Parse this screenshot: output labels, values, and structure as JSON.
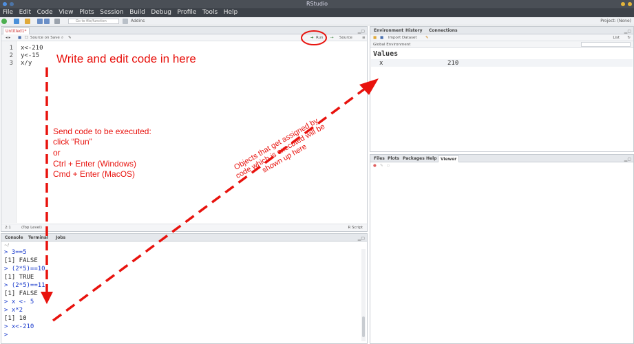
{
  "window": {
    "title": "RStudio"
  },
  "menu": [
    "File",
    "Edit",
    "Code",
    "View",
    "Plots",
    "Session",
    "Build",
    "Debug",
    "Profile",
    "Tools",
    "Help"
  ],
  "toolbar": {
    "goto_placeholder": "Go to file/function",
    "addins": "Addins",
    "project": "Project: (None)"
  },
  "editor": {
    "tab": "Untitled1*",
    "source_on_save": "Source on Save",
    "run": "Run",
    "source": "Source",
    "lines": [
      {
        "num": "1",
        "code": "x<-210"
      },
      {
        "num": "2",
        "code": "y<-15"
      },
      {
        "num": "3",
        "code": "x/y"
      }
    ],
    "status_pos": "2:1",
    "status_scope": "(Top Level)",
    "status_type": "R Script"
  },
  "console": {
    "tabs": [
      "Console",
      "Terminal",
      "Jobs"
    ],
    "path": "~/",
    "lines": [
      {
        "kind": "prompt",
        "text": "> 3==5"
      },
      {
        "kind": "out",
        "text": "[1] FALSE"
      },
      {
        "kind": "prompt",
        "text": "> (2*5)==10"
      },
      {
        "kind": "out",
        "text": "[1] TRUE"
      },
      {
        "kind": "prompt",
        "text": "> (2*5)==11"
      },
      {
        "kind": "out",
        "text": "[1] FALSE"
      },
      {
        "kind": "prompt",
        "text": "> x <- 5"
      },
      {
        "kind": "prompt",
        "text": "> x*2"
      },
      {
        "kind": "out",
        "text": "[1] 10"
      },
      {
        "kind": "prompt",
        "text": "> x<-210"
      },
      {
        "kind": "prompt",
        "text": ">"
      }
    ]
  },
  "environment": {
    "tabs": [
      "Environment",
      "History",
      "Connections"
    ],
    "import": "Import Dataset",
    "list": "List",
    "scope": "Global Environment",
    "section": "Values",
    "rows": [
      {
        "name": "x",
        "value": "210"
      }
    ]
  },
  "files": {
    "tabs": [
      "Files",
      "Plots",
      "Packages",
      "Help",
      "Viewer"
    ]
  },
  "annotations": {
    "write": "Write and edit code in here",
    "send_1": "Send code to be executed:",
    "send_2": "click “Run”",
    "send_3": "or",
    "send_4": "Ctrl + Enter (Windows)",
    "send_5": "Cmd + Enter (MacOS)",
    "obj_1": "Objects that get assigned by",
    "obj_2": "code which is executed will be",
    "obj_3": "shown up here"
  },
  "colors": {
    "annotation": "#e8130e",
    "prompt": "#1a3bcc",
    "menubar": "#3d4249"
  }
}
